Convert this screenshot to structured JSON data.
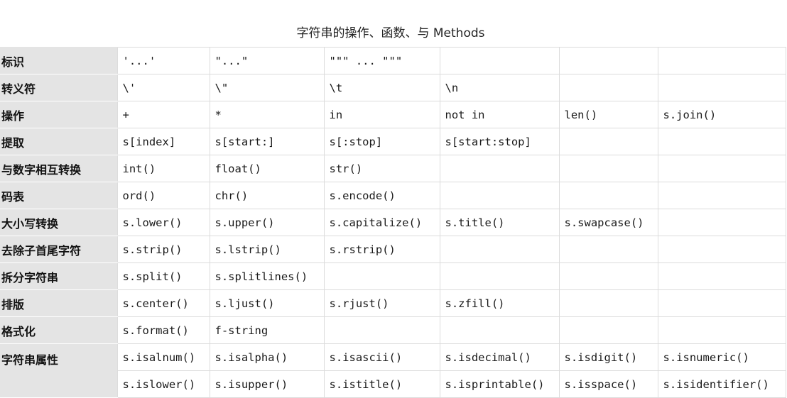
{
  "title": "字符串的操作、函数、与 Methods",
  "rows": [
    {
      "label": "标识",
      "cells": [
        "'...'",
        "\"...\"",
        "\"\"\" ... \"\"\"",
        "",
        "",
        ""
      ]
    },
    {
      "label": "转义符",
      "cells": [
        "\\'",
        "\\\"",
        "\\t",
        "\\n",
        "",
        ""
      ]
    },
    {
      "label": "操作",
      "cells": [
        "+",
        "*",
        "in",
        "not in",
        "len()",
        "s.join()"
      ]
    },
    {
      "label": "提取",
      "cells": [
        "s[index]",
        "s[start:]",
        "s[:stop]",
        "s[start:stop]",
        "",
        ""
      ]
    },
    {
      "label": "与数字相互转换",
      "cells": [
        "int()",
        "float()",
        "str()",
        "",
        "",
        ""
      ]
    },
    {
      "label": "码表",
      "cells": [
        "ord()",
        "chr()",
        "s.encode()",
        "",
        "",
        ""
      ]
    },
    {
      "label": "大小写转换",
      "cells": [
        "s.lower()",
        "s.upper()",
        "s.capitalize()",
        "s.title()",
        "s.swapcase()",
        ""
      ]
    },
    {
      "label": "去除子首尾字符",
      "cells": [
        "s.strip()",
        "s.lstrip()",
        "s.rstrip()",
        "",
        "",
        ""
      ]
    },
    {
      "label": "拆分字符串",
      "cells": [
        "s.split()",
        "s.splitlines()",
        "",
        "",
        "",
        ""
      ]
    },
    {
      "label": "排版",
      "cells": [
        "s.center()",
        "s.ljust()",
        "s.rjust()",
        "s.zfill()",
        "",
        ""
      ]
    },
    {
      "label": "格式化",
      "cells": [
        "s.format()",
        "f-string",
        "",
        "",
        "",
        ""
      ]
    },
    {
      "label": "字符串属性",
      "cells": [
        "s.isalnum()",
        "s.isalpha()",
        "s.isascii()",
        "s.isdecimal()",
        "s.isdigit()",
        "s.isnumeric()"
      ]
    },
    {
      "label": "",
      "cells": [
        "s.islower()",
        "s.isupper()",
        "s.istitle()",
        "s.isprintable()",
        "s.isspace()",
        "s.isidentifier()"
      ]
    }
  ]
}
